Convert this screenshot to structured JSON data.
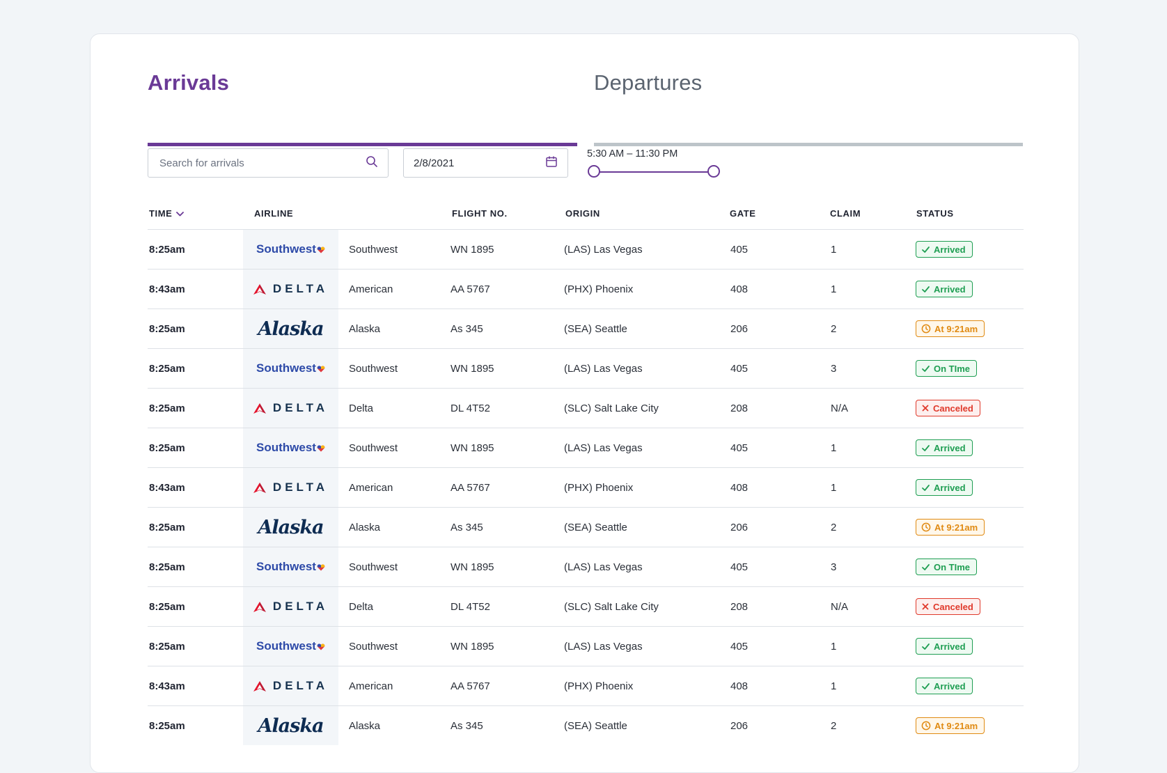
{
  "tabs": {
    "arrivals": "Arrivals",
    "departures": "Departures"
  },
  "filters": {
    "search_placeholder": "Search for arrivals",
    "date": "2/8/2021",
    "time_range": "5:30 AM – 11:30 PM"
  },
  "colors": {
    "accent": "#6a3a96",
    "arrived": "#1e9e52",
    "delayed": "#e08a12",
    "canceled": "#e0392b"
  },
  "table": {
    "headers": {
      "time": "TIME",
      "airline": "AIRLINE",
      "flight": "FLIGHT NO.",
      "origin": "ORIGIN",
      "gate": "GATE",
      "claim": "CLAIM",
      "status": "STATUS"
    },
    "rows": [
      {
        "time": "8:25am",
        "logo": "Southwest",
        "airline": "Southwest",
        "flight": "WN 1895",
        "origin": "(LAS) Las Vegas",
        "gate": "405",
        "claim": "1",
        "status": "Arrived",
        "status_type": "arrived"
      },
      {
        "time": "8:43am",
        "logo": "DELTA",
        "airline": "American",
        "flight": "AA 5767",
        "origin": "(PHX) Phoenix",
        "gate": "408",
        "claim": "1",
        "status": "Arrived",
        "status_type": "arrived"
      },
      {
        "time": "8:25am",
        "logo": "Alaska",
        "airline": "Alaska",
        "flight": "As 345",
        "origin": "(SEA) Seattle",
        "gate": "206",
        "claim": "2",
        "status": "At 9:21am",
        "status_type": "delayed"
      },
      {
        "time": "8:25am",
        "logo": "Southwest",
        "airline": "Southwest",
        "flight": "WN 1895",
        "origin": "(LAS) Las Vegas",
        "gate": "405",
        "claim": "3",
        "status": "On TIme",
        "status_type": "arrived"
      },
      {
        "time": "8:25am",
        "logo": "DELTA",
        "airline": "Delta",
        "flight": "DL 4T52",
        "origin": "(SLC) Salt Lake City",
        "gate": "208",
        "claim": "N/A",
        "status": "Canceled",
        "status_type": "canceled"
      },
      {
        "time": "8:25am",
        "logo": "Southwest",
        "airline": "Southwest",
        "flight": "WN 1895",
        "origin": "(LAS) Las Vegas",
        "gate": "405",
        "claim": "1",
        "status": "Arrived",
        "status_type": "arrived"
      },
      {
        "time": "8:43am",
        "logo": "DELTA",
        "airline": "American",
        "flight": "AA 5767",
        "origin": "(PHX) Phoenix",
        "gate": "408",
        "claim": "1",
        "status": "Arrived",
        "status_type": "arrived"
      },
      {
        "time": "8:25am",
        "logo": "Alaska",
        "airline": "Alaska",
        "flight": "As 345",
        "origin": "(SEA) Seattle",
        "gate": "206",
        "claim": "2",
        "status": "At 9:21am",
        "status_type": "delayed"
      },
      {
        "time": "8:25am",
        "logo": "Southwest",
        "airline": "Southwest",
        "flight": "WN 1895",
        "origin": "(LAS) Las Vegas",
        "gate": "405",
        "claim": "3",
        "status": "On TIme",
        "status_type": "arrived"
      },
      {
        "time": "8:25am",
        "logo": "DELTA",
        "airline": "Delta",
        "flight": "DL 4T52",
        "origin": "(SLC) Salt Lake City",
        "gate": "208",
        "claim": "N/A",
        "status": "Canceled",
        "status_type": "canceled"
      },
      {
        "time": "8:25am",
        "logo": "Southwest",
        "airline": "Southwest",
        "flight": "WN 1895",
        "origin": "(LAS) Las Vegas",
        "gate": "405",
        "claim": "1",
        "status": "Arrived",
        "status_type": "arrived"
      },
      {
        "time": "8:43am",
        "logo": "DELTA",
        "airline": "American",
        "flight": "AA 5767",
        "origin": "(PHX) Phoenix",
        "gate": "408",
        "claim": "1",
        "status": "Arrived",
        "status_type": "arrived"
      },
      {
        "time": "8:25am",
        "logo": "Alaska",
        "airline": "Alaska",
        "flight": "As 345",
        "origin": "(SEA) Seattle",
        "gate": "206",
        "claim": "2",
        "status": "At 9:21am",
        "status_type": "delayed"
      }
    ]
  }
}
